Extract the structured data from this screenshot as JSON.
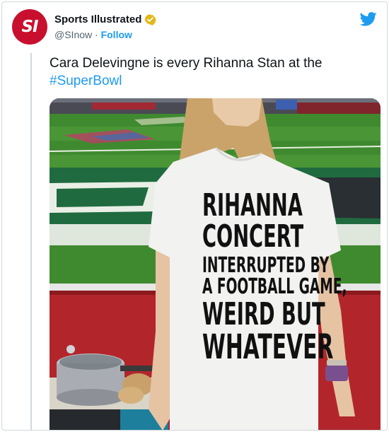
{
  "account": {
    "display_name": "Sports Illustrated",
    "avatar_text": "SI",
    "handle": "@SInow",
    "separator": " · ",
    "follow_label": "Follow"
  },
  "tweet": {
    "text": "Cara Delevingne is every Rihanna Stan at the",
    "hashtag": "#SuperBowl"
  },
  "image": {
    "shirt_lines": [
      "RIHANNA",
      "CONCERT",
      "INTERRUPTED BY",
      "A FOOTBALL GAME,",
      "WEIRD BUT",
      "WHATEVER"
    ]
  },
  "colors": {
    "brand_red": "#c8102e",
    "link_blue": "#1d9bf0",
    "verified_gold": "#e2b719"
  },
  "icons": {
    "verified": "verified-badge-icon",
    "platform": "twitter-bird-icon"
  }
}
